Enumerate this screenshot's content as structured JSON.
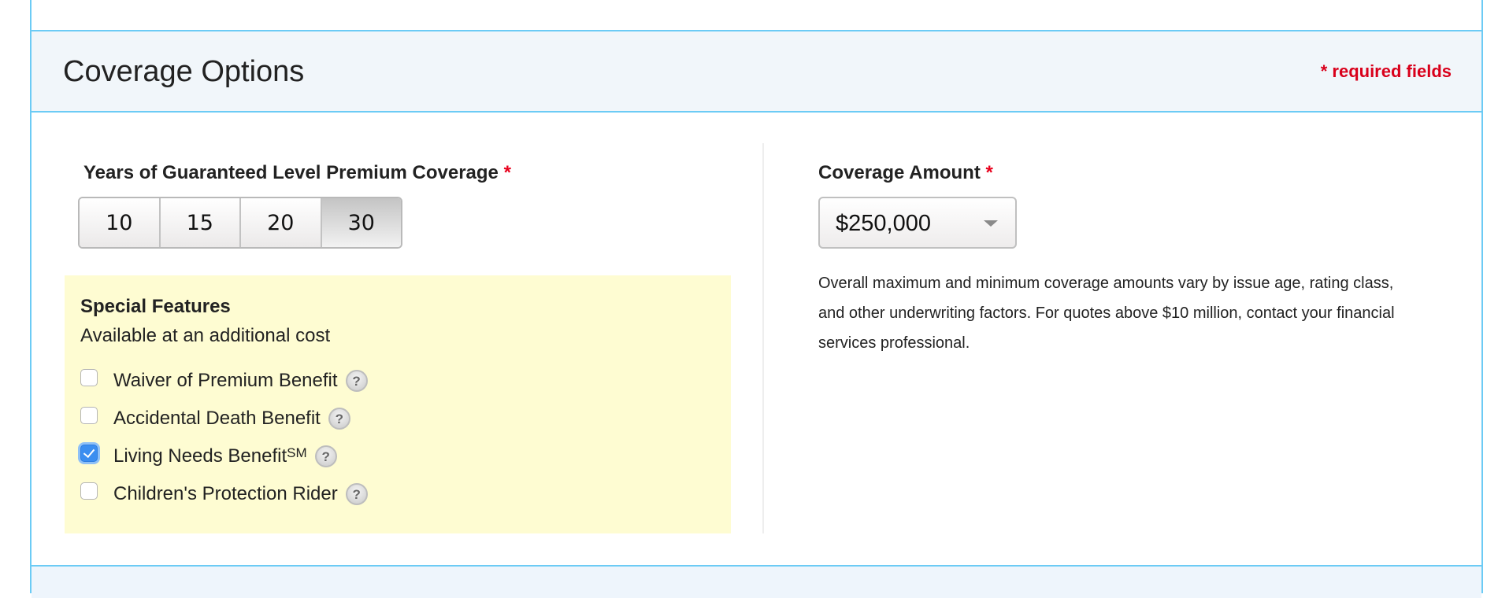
{
  "section": {
    "title": "Coverage Options",
    "required_note": "* required fields"
  },
  "years": {
    "label": "Years of Guaranteed Level Premium Coverage",
    "required_marker": "*",
    "options": [
      {
        "label": "10",
        "selected": false
      },
      {
        "label": "15",
        "selected": false
      },
      {
        "label": "20",
        "selected": false
      },
      {
        "label": "30",
        "selected": true
      }
    ],
    "selected": "30"
  },
  "special_features": {
    "title": "Special Features",
    "subtitle": "Available at an additional cost",
    "items": [
      {
        "label": "Waiver of Premium Benefit",
        "superscript": "",
        "checked": false,
        "help_icon": "question-circle-icon"
      },
      {
        "label": "Accidental Death Benefit",
        "superscript": "",
        "checked": false,
        "help_icon": "question-circle-icon"
      },
      {
        "label": "Living Needs Benefit",
        "superscript": "SM",
        "checked": true,
        "help_icon": "question-circle-icon"
      },
      {
        "label": "Children's Protection Rider",
        "superscript": "",
        "checked": false,
        "help_icon": "question-circle-icon"
      }
    ]
  },
  "coverage_amount": {
    "label": "Coverage Amount",
    "required_marker": "*",
    "selected_value": "$250,000",
    "note": "Overall maximum and minimum coverage amounts vary by issue age, rating class, and other underwriting factors. For quotes above $10 million, contact your financial services professional."
  },
  "icons": {
    "help": "?"
  },
  "colors": {
    "accent_border": "#6ccbf5",
    "header_bg": "#f1f6fa",
    "required_red": "#d9001b",
    "features_bg": "#fefcd2",
    "checkbox_checked": "#3b8ef0"
  }
}
